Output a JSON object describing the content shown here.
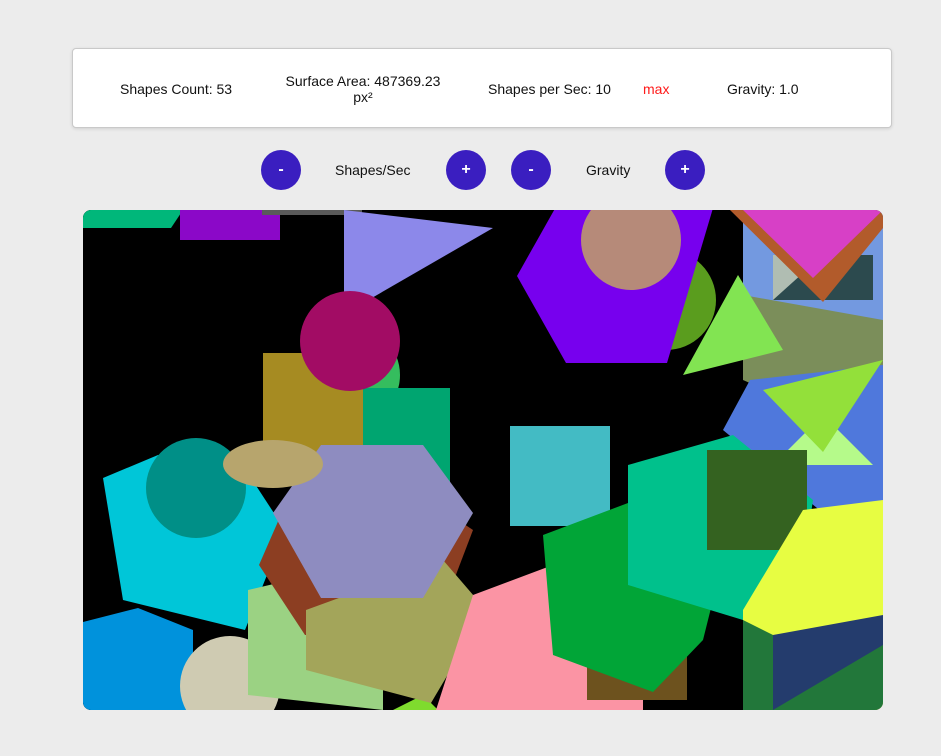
{
  "stats": {
    "shapes_count": "Shapes Count: 53",
    "surface_area_line1": "Surface Area: 487369.23",
    "surface_area_line2": "px²",
    "shapes_per_sec": "Shapes per Sec: 10",
    "max_label": "max",
    "gravity": "Gravity: 1.0"
  },
  "controls": {
    "rate_decrease": "-",
    "rate_label": "Shapes/Sec",
    "rate_increase": "+",
    "gravity_decrease": "-",
    "gravity_label": "Gravity",
    "gravity_increase": "+"
  },
  "colors": {
    "button": "#3a1ec0",
    "max_text": "#ff1a1a",
    "canvas_bg": "#000000"
  }
}
